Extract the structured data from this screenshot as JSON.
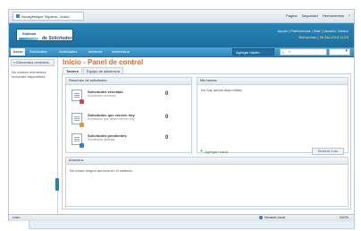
{
  "browser": {
    "tab_title": "Novagéstique Sapiens.../inicio",
    "tools": [
      "Página",
      "Seguridad",
      "Herramientas",
      "?"
    ]
  },
  "app": {
    "logo_line1": "Sistema",
    "logo_line2": "de Solicitudes",
    "user_links": "Ayuda | Preferencias | Salir | Usuario: Gestor",
    "session_line": "Bienvenido | 28 Abr 2013 11:20"
  },
  "nav": {
    "items": [
      "Inicio",
      "Solicitudes",
      "Actividades",
      "Informes",
      "Administrar"
    ],
    "quick_request": "Agregar rápido",
    "search_placeholder": "Ir"
  },
  "sidebar": {
    "header": "Elementos recientes",
    "empty_text": "No existen elementos recientes disponibles."
  },
  "main": {
    "title": "Inicio - Panel de control",
    "tabs": [
      "Tablero",
      "Equipo de asistencia"
    ]
  },
  "requests_panel": {
    "title": "Resumen de solicitudes",
    "items": [
      {
        "title": "Solicitudes vencidas",
        "subtitle": "Solicitudes vencidas",
        "count": "0",
        "badge_color": "#d9463a"
      },
      {
        "title": "Solicitudes que vencen hoy",
        "subtitle": "Solicitudes que deben vencer hoy",
        "count": "0",
        "badge_color": "#e59a2a"
      },
      {
        "title": "Solicitudes pendientes",
        "subtitle": "Solicitudes abiertas",
        "count": "0",
        "badge_color": "#3a7fc2"
      }
    ]
  },
  "tasks_panel": {
    "title": "Mis tareas",
    "empty_text": "No hay tareas disponibles",
    "add_label": "Agregar nueva",
    "show_all_label": "Mostrar todo"
  },
  "ads_panel": {
    "title": "Anuncios",
    "empty_text": "No existe ningún anuncio en el sistema."
  },
  "status_bar": {
    "left_text": "Listo",
    "zone_text": "Intranet local",
    "zoom_text": "100%"
  }
}
